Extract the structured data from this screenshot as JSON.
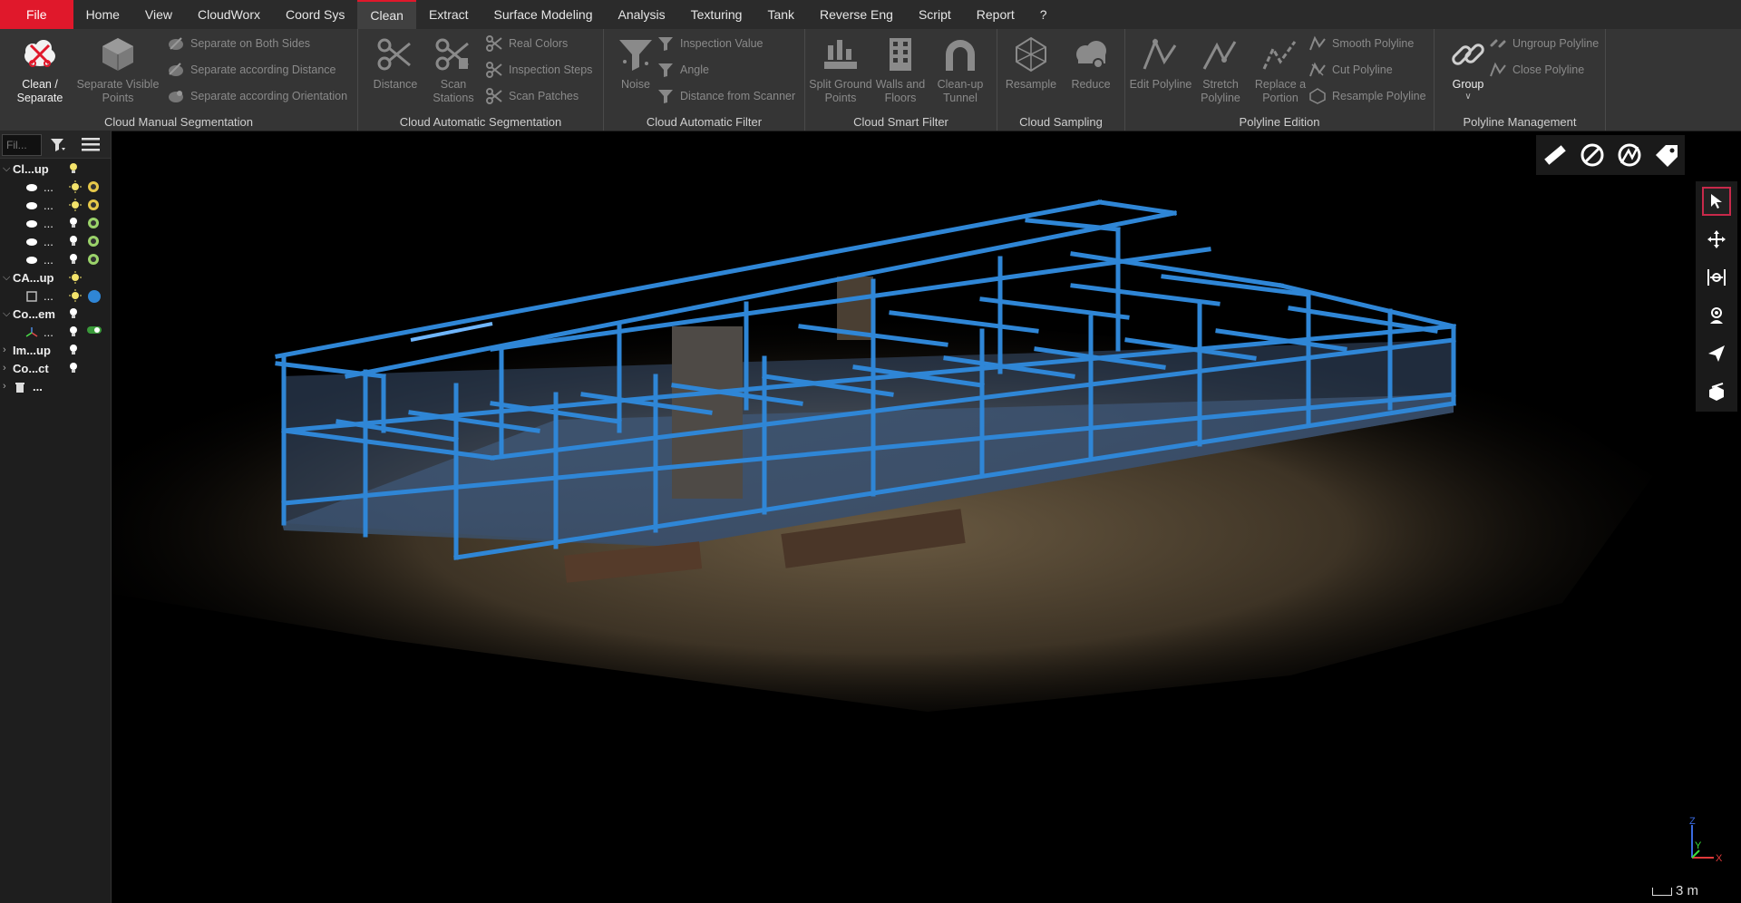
{
  "menu": {
    "items": [
      "File",
      "Home",
      "View",
      "CloudWorx",
      "Coord Sys",
      "Clean",
      "Extract",
      "Surface Modeling",
      "Analysis",
      "Texturing",
      "Tank",
      "Reverse Eng",
      "Script",
      "Report",
      "?"
    ]
  },
  "ribbon": {
    "manual_segmentation": {
      "label": "Cloud Manual Segmentation",
      "clean_separate": "Clean / Separate",
      "separate_visible": "Separate Visible Points",
      "separate_both": "Separate on Both Sides",
      "separate_distance": "Separate according Distance",
      "separate_orientation": "Separate according Orientation"
    },
    "automatic_segmentation": {
      "label": "Cloud Automatic Segmentation",
      "distance": "Distance",
      "scan_stations": "Scan Stations",
      "real_colors": "Real Colors",
      "inspection_steps": "Inspection Steps",
      "scan_patches": "Scan Patches"
    },
    "automatic_filter": {
      "label": "Cloud Automatic Filter",
      "noise": "Noise",
      "inspection_value": "Inspection Value",
      "angle": "Angle",
      "distance_scanner": "Distance from Scanner"
    },
    "smart_filter": {
      "label": "Cloud Smart Filter",
      "split_ground": "Split Ground Points",
      "walls_floors": "Walls and Floors",
      "cleanup_tunnel": "Clean-up Tunnel"
    },
    "sampling": {
      "label": "Cloud Sampling",
      "resample": "Resample",
      "reduce": "Reduce"
    },
    "polyline_edition": {
      "label": "Polyline Edition",
      "edit": "Edit Polyline",
      "stretch": "Stretch Polyline",
      "replace": "Replace a Portion",
      "smooth": "Smooth Polyline",
      "cut": "Cut Polyline",
      "resample": "Resample Polyline"
    },
    "polyline_management": {
      "label": "Polyline Management",
      "group": "Group",
      "ungroup": "Ungroup Polyline",
      "close": "Close Polyline"
    }
  },
  "panel": {
    "filter_placeholder": "Fil...",
    "tree": [
      {
        "label": "Cl...up"
      },
      {
        "label": "..."
      },
      {
        "label": "..."
      },
      {
        "label": "..."
      },
      {
        "label": "..."
      },
      {
        "label": "..."
      },
      {
        "label": "CA...up"
      },
      {
        "label": "..."
      },
      {
        "label": "Co...em"
      },
      {
        "label": "..."
      },
      {
        "label": "Im...up"
      },
      {
        "label": "Co...ct"
      },
      {
        "label": "..."
      }
    ]
  },
  "viewport": {
    "scale_label": "3 m",
    "axis_x": "X",
    "axis_y": "Y",
    "axis_z": "Z"
  },
  "colors": {
    "accent": "#e0182b",
    "steel": "#2f86d6",
    "steel_light": "#6fb6ff",
    "ground": "#5a4a34"
  }
}
